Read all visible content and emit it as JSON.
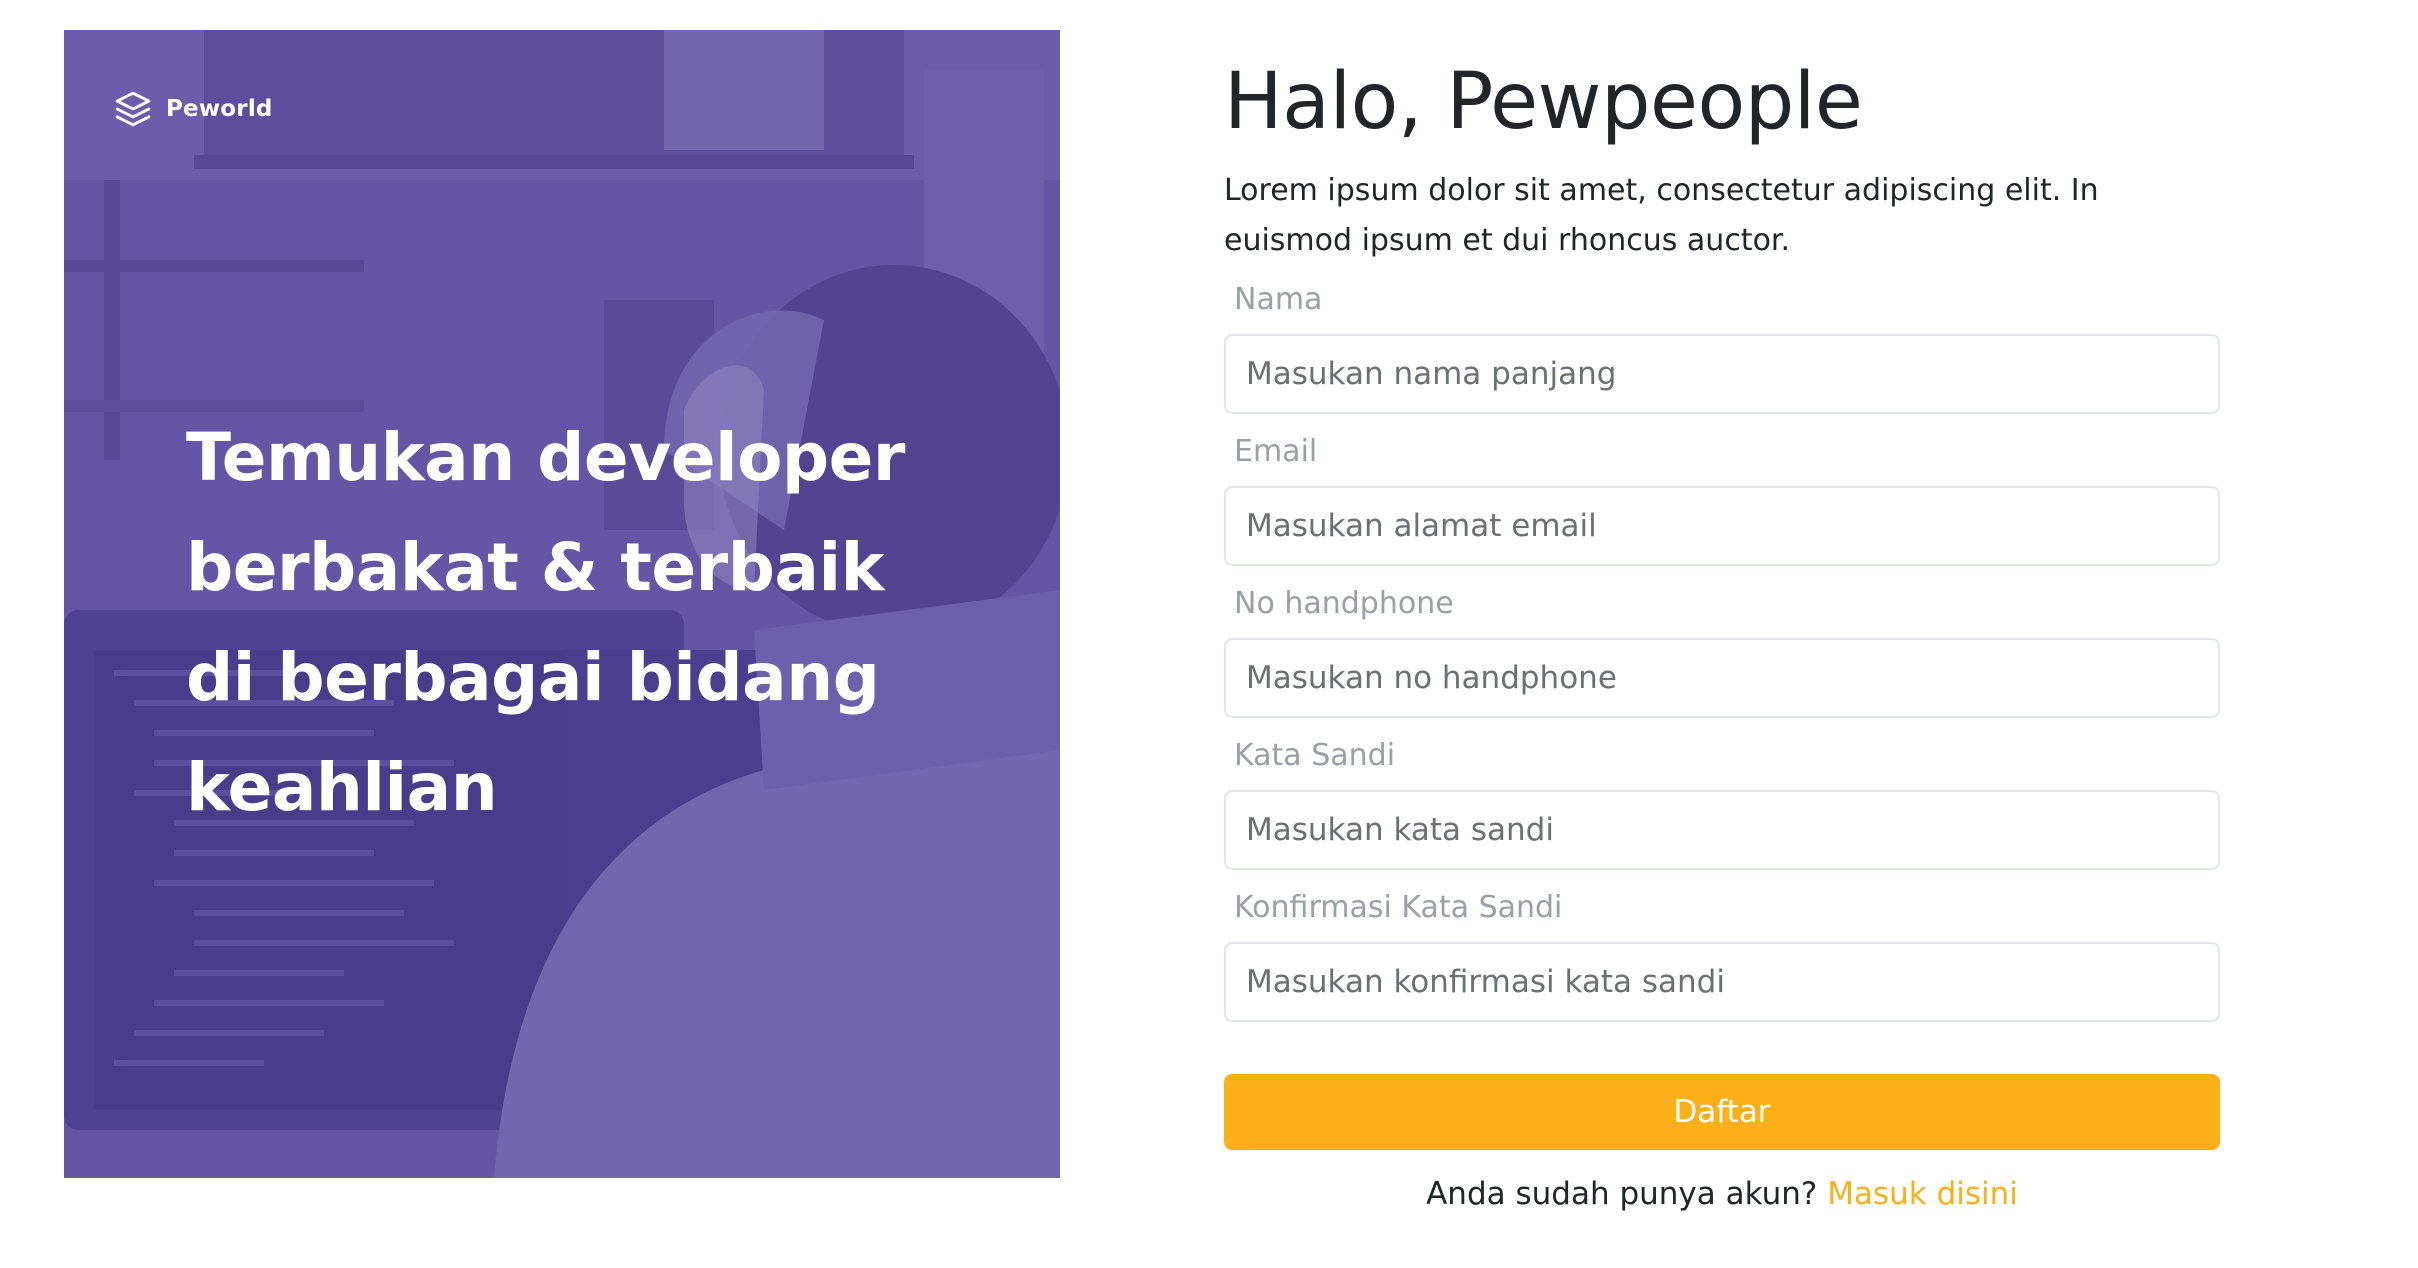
{
  "brand": {
    "name": "Peworld",
    "icon": "layers-icon"
  },
  "hero": {
    "lines": [
      "Temukan developer",
      "berbakat & terbaik",
      "di berbagai bidang",
      "keahlian"
    ],
    "tint_color": "#5e50a1"
  },
  "form": {
    "title": "Halo, Pewpeople",
    "description": "Lorem ipsum dolor sit amet, consectetur adipiscing elit. In euismod ipsum et dui rhoncus auctor.",
    "fields": [
      {
        "label": "Nama",
        "placeholder": "Masukan nama panjang"
      },
      {
        "label": "Email",
        "placeholder": "Masukan alamat email"
      },
      {
        "label": "No handphone",
        "placeholder": "Masukan no handphone"
      },
      {
        "label": "Kata Sandi",
        "placeholder": "Masukan kata sandi"
      },
      {
        "label": "Konfirmasi Kata Sandi",
        "placeholder": "Masukan konfirmasi kata sandi"
      }
    ],
    "submit_label": "Daftar",
    "signin_prompt": "Anda sudah punya akun?",
    "signin_link": "Masuk disini",
    "accent_color": "#fbb017"
  }
}
